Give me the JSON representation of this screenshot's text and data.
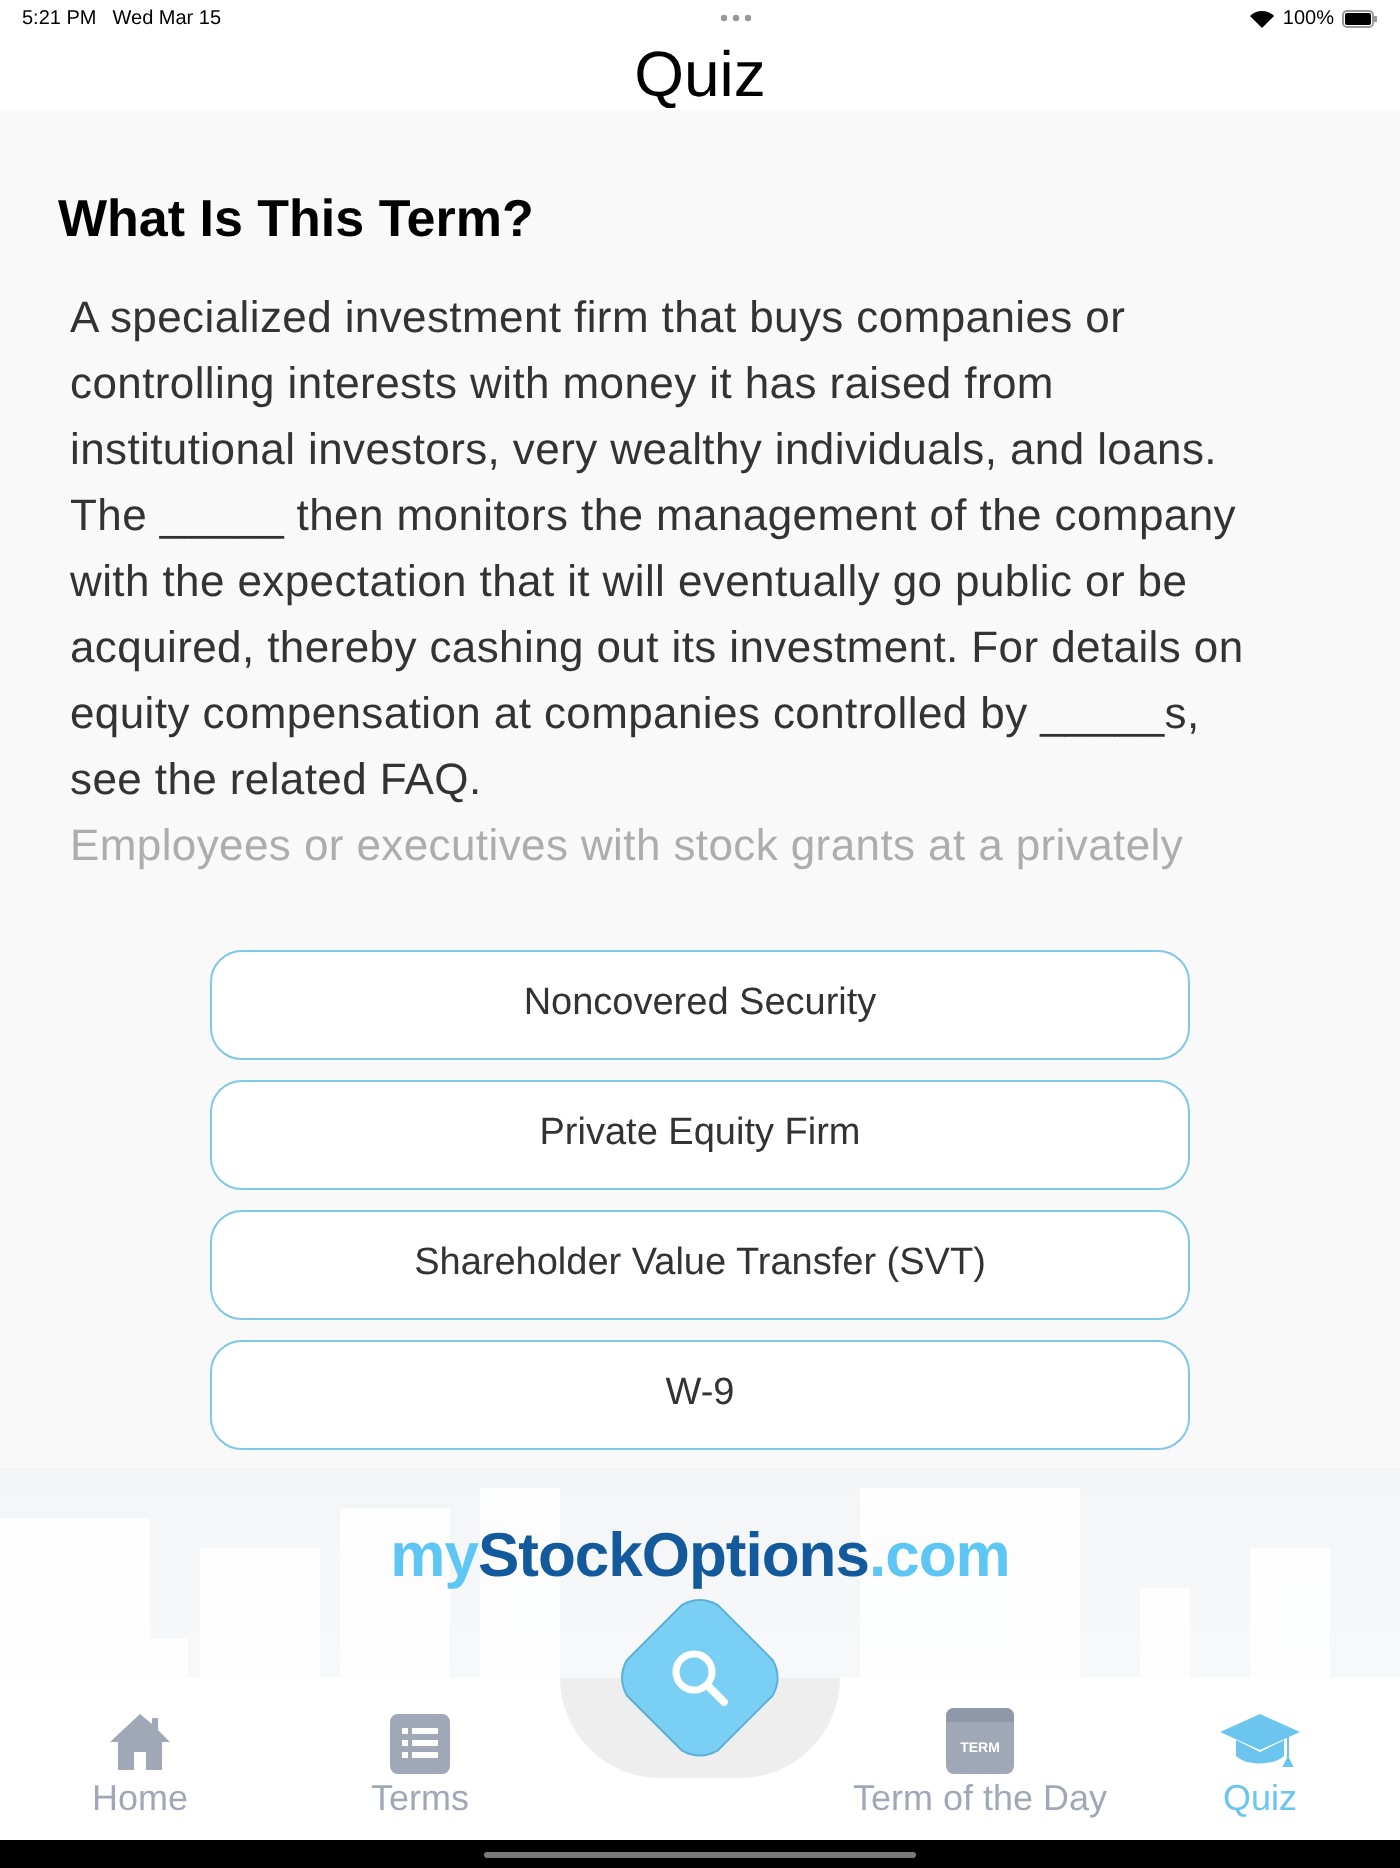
{
  "status_bar": {
    "time": "5:21 PM",
    "date": "Wed Mar 15",
    "battery": "100%"
  },
  "title": "Quiz",
  "question": {
    "heading": "What Is This Term?",
    "text": "A specialized investment firm that buys companies or controlling interests with money it has raised from institutional investors, very wealthy individuals, and loans. The _____ then monitors the management of the company with the expectation that it will eventually go public or be acquired, thereby cashing out its investment. For details on equity compensation at companies controlled by _____s, see the related FAQ.",
    "faded_lines": [
      "Employees or executives with stock grants at a privately"
    ]
  },
  "answers": [
    {
      "label": "Noncovered Security"
    },
    {
      "label": "Private Equity Firm"
    },
    {
      "label": "Shareholder Value Transfer (SVT)"
    },
    {
      "label": "W-9"
    }
  ],
  "logo": [
    "my",
    "StockOptions",
    ".com"
  ],
  "tabs": [
    {
      "kind": "home",
      "label": "Home",
      "selected": false
    },
    {
      "kind": "terms",
      "label": "Terms",
      "selected": false
    },
    {
      "kind": "search",
      "selected": false
    },
    {
      "kind": "calendar",
      "label": "Term of the Day",
      "badge": "TERM",
      "selected": false
    },
    {
      "kind": "quiz",
      "label": "Quiz",
      "selected": true
    }
  ]
}
